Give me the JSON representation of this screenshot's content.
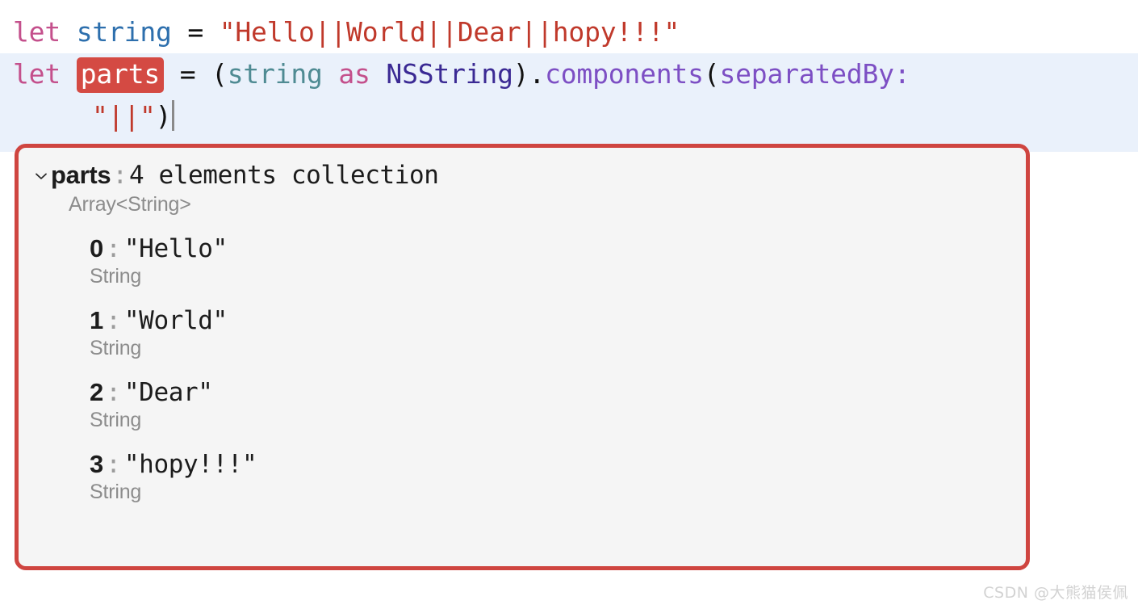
{
  "editor": {
    "lines": [
      {
        "id": "line-1",
        "highlighted": false,
        "tokens": [
          {
            "t": "let",
            "c": "kw"
          },
          {
            "t": " ",
            "c": "plain"
          },
          {
            "t": "string",
            "c": "decl"
          },
          {
            "t": " = ",
            "c": "plain"
          },
          {
            "t": "\"Hello||World||Dear||hopy!!!\"",
            "c": "str"
          }
        ]
      },
      {
        "id": "line-2",
        "highlighted": true,
        "tokens": [
          {
            "t": "let",
            "c": "kw"
          },
          {
            "t": " ",
            "c": "plain"
          },
          {
            "t": "parts",
            "c": "badge"
          },
          {
            "t": " = (",
            "c": "plain"
          },
          {
            "t": "string",
            "c": "var"
          },
          {
            "t": " ",
            "c": "plain"
          },
          {
            "t": "as",
            "c": "kw"
          },
          {
            "t": " ",
            "c": "plain"
          },
          {
            "t": "NSString",
            "c": "type"
          },
          {
            "t": ")",
            "c": "plain"
          },
          {
            "t": ".",
            "c": "plain"
          },
          {
            "t": "components",
            "c": "method"
          },
          {
            "t": "(",
            "c": "plain"
          },
          {
            "t": "separatedBy",
            "c": "label"
          },
          {
            "t": ":",
            "c": "label"
          }
        ]
      },
      {
        "id": "line-3",
        "highlighted": true,
        "continuation": true,
        "tokens": [
          {
            "t": "\"||\"",
            "c": "str"
          },
          {
            "t": ")",
            "c": "plain"
          },
          {
            "t": "",
            "c": "caret"
          }
        ]
      }
    ],
    "full_source": "let string = \"Hello||World||Dear||hopy!!!\"\nlet parts = (string as NSString).components(separatedBy: \"||\")"
  },
  "result_panel": {
    "border_color": "#cf4540",
    "background_color": "#f5f5f5",
    "disclosure_icon": "chevron-down-icon",
    "expanded": true,
    "root": {
      "name": "parts",
      "separator": ":",
      "summary": "4 elements collection",
      "type": "Array<String>"
    },
    "children": [
      {
        "index": "0",
        "separator": ":",
        "value": "\"Hello\"",
        "type": "String"
      },
      {
        "index": "1",
        "separator": ":",
        "value": "\"World\"",
        "type": "String"
      },
      {
        "index": "2",
        "separator": ":",
        "value": "\"Dear\"",
        "type": "String"
      },
      {
        "index": "3",
        "separator": ":",
        "value": "\"hopy!!!\"",
        "type": "String"
      }
    ]
  },
  "watermark": {
    "text": "CSDN @大熊猫侯佩"
  },
  "colors": {
    "keyword": "#c4508c",
    "declaration": "#2d6fad",
    "string_literal": "#c0392b",
    "variable_ref": "#4f8b93",
    "type_name": "#3b2a94",
    "method_name": "#7d4fc4",
    "argument_label": "#7d4fc4",
    "highlight_band": "#eaf1fb",
    "badge_background": "#d44a43",
    "panel_border": "#cf4540",
    "panel_background": "#f5f5f5",
    "muted_text": "#8c8c8c"
  }
}
